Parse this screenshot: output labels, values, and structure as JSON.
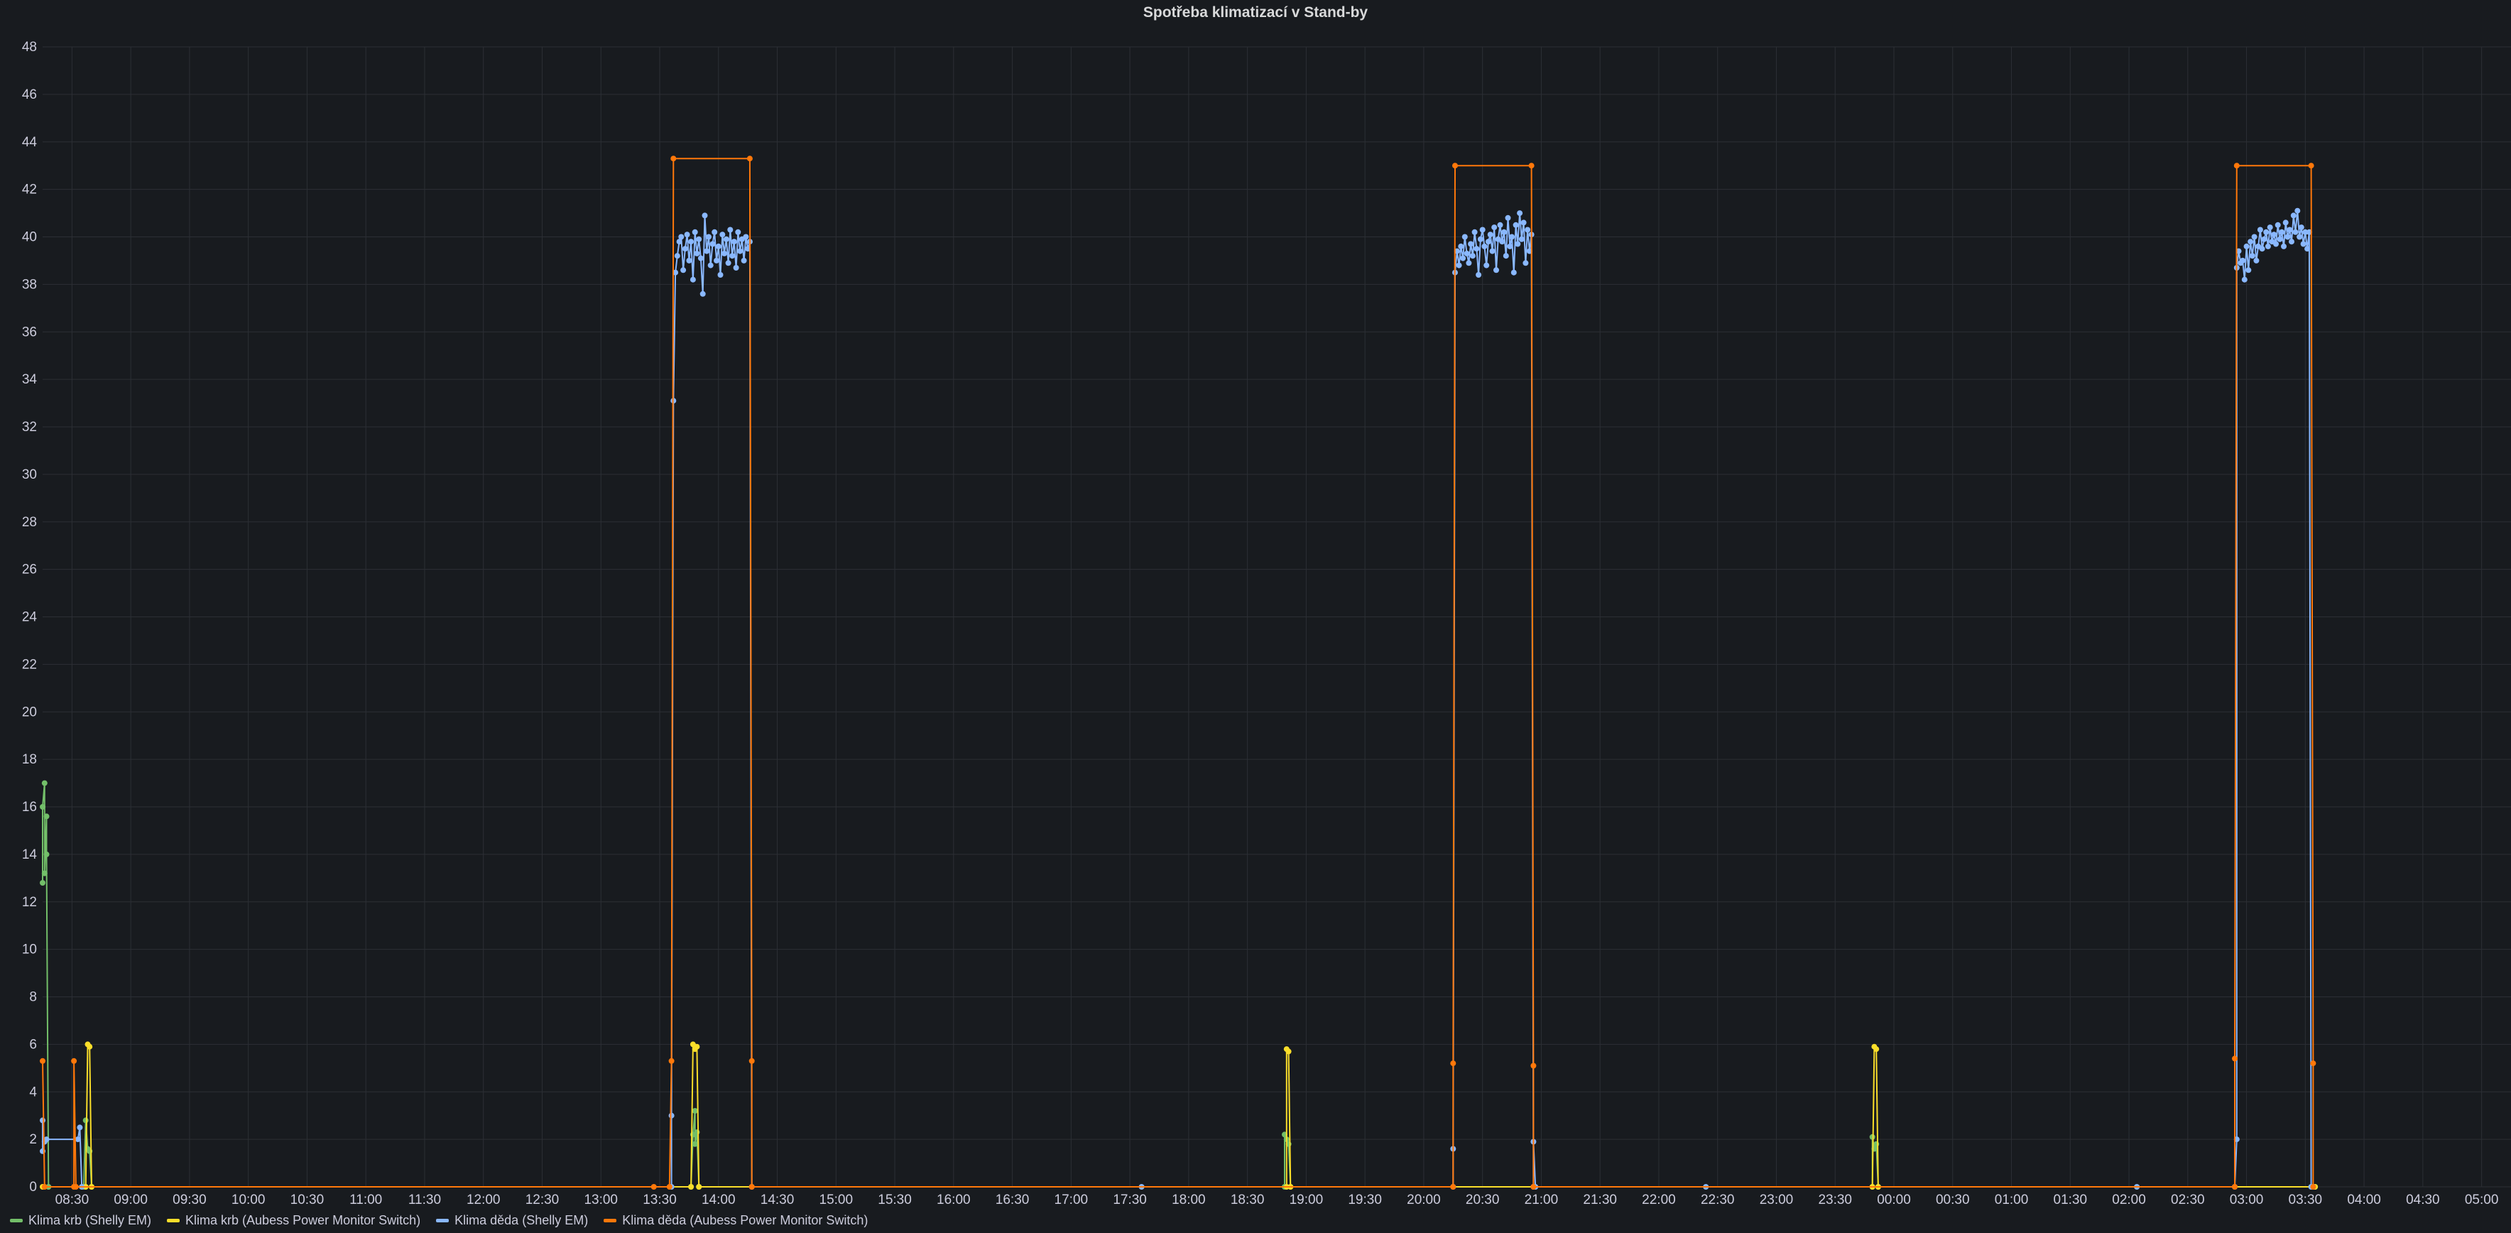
{
  "chart_data": {
    "type": "line",
    "title": "Spotřeba klimatizací v Stand-by",
    "ylabel": "",
    "xlabel": "",
    "ylim": [
      0,
      48
    ],
    "yticks": [
      0,
      2,
      4,
      6,
      8,
      10,
      12,
      14,
      16,
      18,
      20,
      22,
      24,
      26,
      28,
      30,
      32,
      34,
      36,
      38,
      40,
      42,
      44,
      46,
      48
    ],
    "xlim": [
      "08:15",
      "05:15"
    ],
    "xticks": [
      "08:30",
      "09:00",
      "09:30",
      "10:00",
      "10:30",
      "11:00",
      "11:30",
      "12:00",
      "12:30",
      "13:00",
      "13:30",
      "14:00",
      "14:30",
      "15:00",
      "15:30",
      "16:00",
      "16:30",
      "17:00",
      "17:30",
      "18:00",
      "18:30",
      "19:00",
      "19:30",
      "20:00",
      "20:30",
      "21:00",
      "21:30",
      "22:00",
      "22:30",
      "23:00",
      "23:30",
      "00:00",
      "00:30",
      "01:00",
      "01:30",
      "02:00",
      "02:30",
      "03:00",
      "03:30",
      "04:00",
      "04:30",
      "05:00"
    ],
    "grid": true,
    "legend_position": "bottom-left",
    "series": [
      {
        "name": "Klima krb (Shelly EM)",
        "color": "#73bf69",
        "points": [
          [
            "08:15",
            12.8
          ],
          [
            "08:15",
            16.0
          ],
          [
            "08:16",
            17.0
          ],
          [
            "08:16",
            13.2
          ],
          [
            "08:17",
            15.6
          ],
          [
            "08:17",
            14.0
          ],
          [
            "08:18",
            0
          ],
          [
            "08:36",
            0
          ],
          [
            "08:37",
            2.8
          ],
          [
            "08:38",
            1.6
          ],
          [
            "08:39",
            1.5
          ],
          [
            "08:40",
            0
          ],
          [
            "13:46",
            0
          ],
          [
            "13:47",
            2.2
          ],
          [
            "13:48",
            3.2
          ],
          [
            "13:48",
            1.8
          ],
          [
            "13:49",
            2.3
          ],
          [
            "13:50",
            0
          ],
          [
            "18:49",
            0
          ],
          [
            "18:49",
            2.2
          ],
          [
            "18:50",
            2.0
          ],
          [
            "18:51",
            1.8
          ],
          [
            "18:52",
            0
          ],
          [
            "23:49",
            0
          ],
          [
            "23:49",
            2.1
          ],
          [
            "23:50",
            1.6
          ],
          [
            "23:51",
            1.8
          ],
          [
            "23:52",
            0
          ],
          [
            "03:35",
            0
          ]
        ]
      },
      {
        "name": "Klima krb (Aubess Power Monitor Switch)",
        "color": "#fade2a",
        "points": [
          [
            "08:15",
            0
          ],
          [
            "08:37",
            0
          ],
          [
            "08:38",
            6.0
          ],
          [
            "08:39",
            5.9
          ],
          [
            "08:40",
            0
          ],
          [
            "13:46",
            0
          ],
          [
            "13:47",
            6.0
          ],
          [
            "13:48",
            5.8
          ],
          [
            "13:49",
            5.9
          ],
          [
            "13:50",
            0
          ],
          [
            "18:50",
            0
          ],
          [
            "18:50",
            5.8
          ],
          [
            "18:51",
            5.7
          ],
          [
            "18:52",
            0
          ],
          [
            "23:49",
            0
          ],
          [
            "23:50",
            5.9
          ],
          [
            "23:51",
            5.8
          ],
          [
            "23:52",
            0
          ],
          [
            "03:35",
            0
          ]
        ]
      },
      {
        "name": "Klima děda (Shelly EM)",
        "color": "#8ab8ff",
        "points": [
          [
            "08:15",
            2.8
          ],
          [
            "08:15",
            1.5
          ],
          [
            "08:16",
            1.9
          ],
          [
            "08:17",
            2.0
          ],
          [
            "08:33",
            2.0
          ],
          [
            "08:34",
            2.5
          ],
          [
            "08:35",
            0
          ],
          [
            "13:36",
            0
          ],
          [
            "13:36",
            3.0
          ],
          [
            "13:37",
            33.1
          ],
          [
            "13:38",
            38.5
          ],
          [
            "13:39",
            39.2
          ],
          [
            "13:40",
            39.8
          ],
          [
            "13:41",
            40.0
          ],
          [
            "13:42",
            38.6
          ],
          [
            "13:43",
            39.5
          ],
          [
            "13:44",
            40.1
          ],
          [
            "13:45",
            39.0
          ],
          [
            "13:46",
            39.8
          ],
          [
            "13:47",
            38.2
          ],
          [
            "13:48",
            40.2
          ],
          [
            "13:49",
            39.3
          ],
          [
            "13:50",
            39.9
          ],
          [
            "13:51",
            39.1
          ],
          [
            "13:52",
            37.6
          ],
          [
            "13:53",
            40.9
          ],
          [
            "13:54",
            39.4
          ],
          [
            "13:55",
            40.0
          ],
          [
            "13:56",
            38.8
          ],
          [
            "13:57",
            39.7
          ],
          [
            "13:58",
            40.2
          ],
          [
            "13:59",
            39.0
          ],
          [
            "14:00",
            39.6
          ],
          [
            "14:01",
            38.4
          ],
          [
            "14:02",
            40.1
          ],
          [
            "14:03",
            39.3
          ],
          [
            "14:04",
            39.9
          ],
          [
            "14:05",
            38.9
          ],
          [
            "14:06",
            40.3
          ],
          [
            "14:07",
            39.2
          ],
          [
            "14:08",
            39.8
          ],
          [
            "14:09",
            38.7
          ],
          [
            "14:10",
            40.2
          ],
          [
            "14:11",
            39.4
          ],
          [
            "14:12",
            39.9
          ],
          [
            "14:13",
            39.0
          ],
          [
            "14:14",
            40.0
          ],
          [
            "14:15",
            39.5
          ],
          [
            "14:16",
            39.8
          ],
          [
            "14:17",
            0
          ],
          [
            "17:36",
            0
          ],
          [
            "20:15",
            0
          ],
          [
            "20:15",
            1.6
          ],
          [
            "20:16",
            38.5
          ],
          [
            "20:17",
            39.4
          ],
          [
            "20:18",
            38.8
          ],
          [
            "20:19",
            39.6
          ],
          [
            "20:20",
            39.1
          ],
          [
            "20:21",
            40.0
          ],
          [
            "20:22",
            39.3
          ],
          [
            "20:23",
            38.9
          ],
          [
            "20:24",
            39.7
          ],
          [
            "20:25",
            39.2
          ],
          [
            "20:26",
            40.2
          ],
          [
            "20:27",
            39.5
          ],
          [
            "20:28",
            38.4
          ],
          [
            "20:29",
            39.9
          ],
          [
            "20:30",
            40.3
          ],
          [
            "20:31",
            39.6
          ],
          [
            "20:32",
            38.8
          ],
          [
            "20:33",
            39.8
          ],
          [
            "20:34",
            40.1
          ],
          [
            "20:35",
            39.4
          ],
          [
            "20:36",
            40.4
          ],
          [
            "20:37",
            38.6
          ],
          [
            "20:38",
            39.9
          ],
          [
            "20:39",
            40.5
          ],
          [
            "20:40",
            39.8
          ],
          [
            "20:41",
            40.2
          ],
          [
            "20:42",
            39.2
          ],
          [
            "20:43",
            40.8
          ],
          [
            "20:44",
            39.6
          ],
          [
            "20:45",
            40.0
          ],
          [
            "20:46",
            38.5
          ],
          [
            "20:47",
            40.5
          ],
          [
            "20:48",
            39.7
          ],
          [
            "20:49",
            41.0
          ],
          [
            "20:50",
            39.9
          ],
          [
            "20:51",
            40.6
          ],
          [
            "20:52",
            38.9
          ],
          [
            "20:53",
            40.3
          ],
          [
            "20:54",
            39.4
          ],
          [
            "20:55",
            40.1
          ],
          [
            "20:56",
            0
          ],
          [
            "20:56",
            1.9
          ],
          [
            "20:57",
            0
          ],
          [
            "22:24",
            0
          ],
          [
            "02:04",
            0
          ],
          [
            "02:54",
            0
          ],
          [
            "02:55",
            2.0
          ],
          [
            "02:55",
            38.7
          ],
          [
            "02:56",
            39.4
          ],
          [
            "02:57",
            38.9
          ],
          [
            "02:58",
            39.0
          ],
          [
            "02:59",
            38.2
          ],
          [
            "03:00",
            39.6
          ],
          [
            "03:01",
            38.6
          ],
          [
            "03:02",
            39.8
          ],
          [
            "03:03",
            39.2
          ],
          [
            "03:04",
            40.0
          ],
          [
            "03:05",
            39.0
          ],
          [
            "03:06",
            39.6
          ],
          [
            "03:07",
            40.3
          ],
          [
            "03:08",
            39.5
          ],
          [
            "03:09",
            39.9
          ],
          [
            "03:10",
            40.2
          ],
          [
            "03:11",
            39.6
          ],
          [
            "03:12",
            40.4
          ],
          [
            "03:13",
            39.8
          ],
          [
            "03:14",
            40.1
          ],
          [
            "03:15",
            39.7
          ],
          [
            "03:16",
            40.5
          ],
          [
            "03:17",
            39.9
          ],
          [
            "03:18",
            40.2
          ],
          [
            "03:19",
            39.6
          ],
          [
            "03:20",
            40.6
          ],
          [
            "03:21",
            40.0
          ],
          [
            "03:22",
            40.3
          ],
          [
            "03:23",
            39.8
          ],
          [
            "03:24",
            40.9
          ],
          [
            "03:25",
            40.2
          ],
          [
            "03:26",
            41.1
          ],
          [
            "03:27",
            40.0
          ],
          [
            "03:28",
            40.4
          ],
          [
            "03:29",
            39.7
          ],
          [
            "03:30",
            40.2
          ],
          [
            "03:31",
            39.5
          ],
          [
            "03:32",
            40.2
          ],
          [
            "03:33",
            0
          ],
          [
            "03:34",
            0
          ]
        ]
      },
      {
        "name": "Klima děda (Aubess Power Monitor Switch)",
        "color": "#ff780a",
        "points": [
          [
            "08:15",
            5.3
          ],
          [
            "08:16",
            0
          ],
          [
            "08:31",
            0
          ],
          [
            "08:31",
            5.3
          ],
          [
            "08:32",
            0
          ],
          [
            "13:27",
            0
          ],
          [
            "13:35",
            0
          ],
          [
            "13:36",
            5.3
          ],
          [
            "13:37",
            43.3
          ],
          [
            "14:16",
            43.3
          ],
          [
            "14:17",
            5.3
          ],
          [
            "14:17",
            0
          ],
          [
            "20:15",
            0
          ],
          [
            "20:15",
            5.2
          ],
          [
            "20:16",
            43.0
          ],
          [
            "20:55",
            43.0
          ],
          [
            "20:56",
            5.1
          ],
          [
            "20:56",
            0
          ],
          [
            "02:54",
            0
          ],
          [
            "02:54",
            5.4
          ],
          [
            "02:55",
            43.0
          ],
          [
            "03:33",
            43.0
          ],
          [
            "03:34",
            5.2
          ],
          [
            "03:34",
            0
          ]
        ]
      }
    ]
  }
}
